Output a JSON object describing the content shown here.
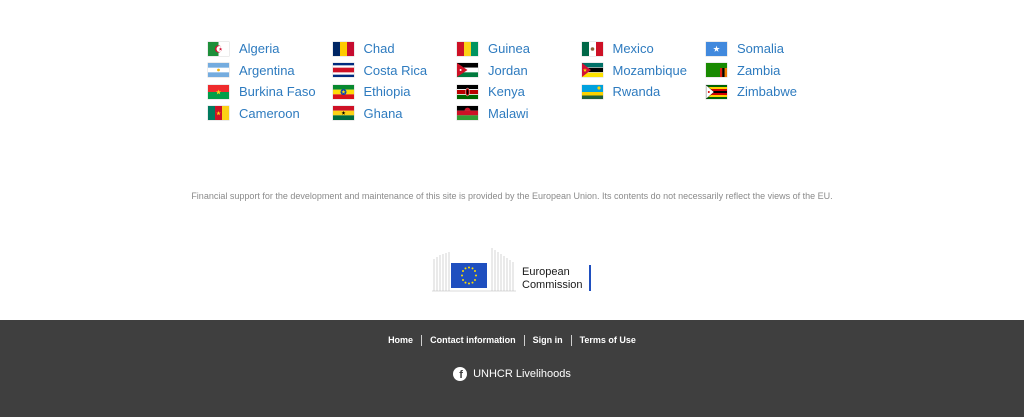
{
  "countries": [
    [
      {
        "name": "Algeria",
        "flag": "algeria-flag-icon"
      },
      {
        "name": "Argentina",
        "flag": "argentina-flag-icon"
      },
      {
        "name": "Burkina Faso",
        "flag": "burkina-faso-flag-icon"
      },
      {
        "name": "Cameroon",
        "flag": "cameroon-flag-icon"
      }
    ],
    [
      {
        "name": "Chad",
        "flag": "chad-flag-icon"
      },
      {
        "name": "Costa Rica",
        "flag": "costa-rica-flag-icon"
      },
      {
        "name": "Ethiopia",
        "flag": "ethiopia-flag-icon"
      },
      {
        "name": "Ghana",
        "flag": "ghana-flag-icon"
      }
    ],
    [
      {
        "name": "Guinea",
        "flag": "guinea-flag-icon"
      },
      {
        "name": "Jordan",
        "flag": "jordan-flag-icon"
      },
      {
        "name": "Kenya",
        "flag": "kenya-flag-icon"
      },
      {
        "name": "Malawi",
        "flag": "malawi-flag-icon"
      }
    ],
    [
      {
        "name": "Mexico",
        "flag": "mexico-flag-icon"
      },
      {
        "name": "Mozambique",
        "flag": "mozambique-flag-icon"
      },
      {
        "name": "Rwanda",
        "flag": "rwanda-flag-icon"
      }
    ],
    [
      {
        "name": "Somalia",
        "flag": "somalia-flag-icon"
      },
      {
        "name": "Zambia",
        "flag": "zambia-flag-icon"
      },
      {
        "name": "Zimbabwe",
        "flag": "zimbabwe-flag-icon"
      }
    ]
  ],
  "disclaimer": "Financial support for the development and maintenance of this site is provided by the European Union. Its contents do not necessarily reflect the views of the EU.",
  "ec_logo": {
    "line1": "European",
    "line2": "Commission"
  },
  "footer": {
    "links": [
      "Home",
      "Contact information",
      "Sign in",
      "Terms of Use"
    ],
    "social_label": "UNHCR Livelihoods",
    "social_icon": "facebook-icon"
  },
  "colors": {
    "link": "#2e7bbf",
    "footer_bg": "#3f3f3f",
    "disclaimer": "#8a8a8a",
    "eu_blue": "#1f4fbf",
    "eu_star": "#ffdd00"
  }
}
